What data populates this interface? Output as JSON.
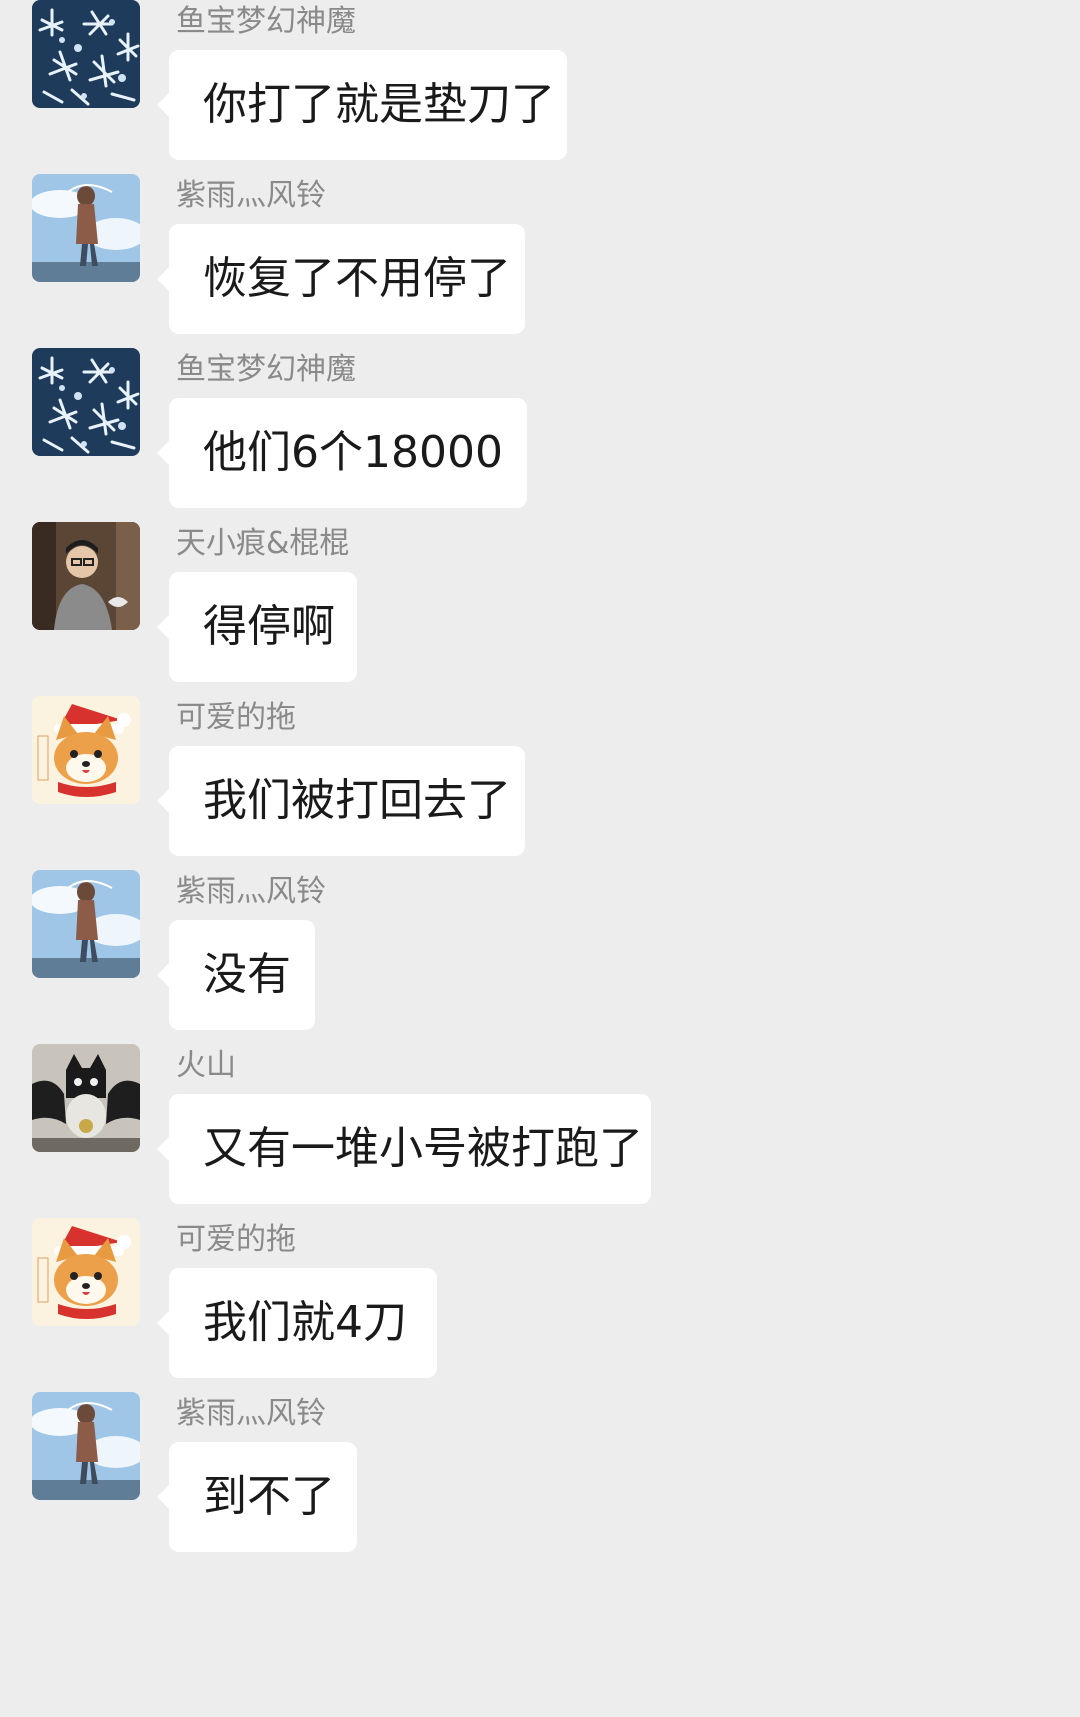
{
  "messages": [
    {
      "sender": "鱼宝梦幻神魔",
      "text": "你打了就是垫刀了",
      "avatar": "snow-crystal-avatar"
    },
    {
      "sender": "紫雨灬风铃",
      "text": "恢复了不用停了",
      "avatar": "anime-couple-sky-avatar"
    },
    {
      "sender": "鱼宝梦幻神魔",
      "text": "他们6个18000",
      "avatar": "snow-crystal-avatar"
    },
    {
      "sender": "天小痕&棍棍",
      "text": "得停啊",
      "avatar": "photo-person-avatar"
    },
    {
      "sender": "可爱的拖",
      "text": "我们被打回去了",
      "avatar": "shiba-santa-avatar"
    },
    {
      "sender": "紫雨灬风铃",
      "text": "没有",
      "avatar": "anime-couple-sky-avatar"
    },
    {
      "sender": "火山",
      "text": "又有一堆小号被打跑了",
      "avatar": "bat-cat-avatar"
    },
    {
      "sender": "可爱的拖",
      "text": "我们就4刀",
      "avatar": "shiba-santa-avatar"
    },
    {
      "sender": "紫雨灬风铃",
      "text": "到不了",
      "avatar": "anime-couple-sky-avatar"
    }
  ],
  "colors": {
    "background": "#ededed",
    "bubble": "#ffffff",
    "sender_name": "#8a8a8a",
    "message_text": "#1a1a1a"
  }
}
